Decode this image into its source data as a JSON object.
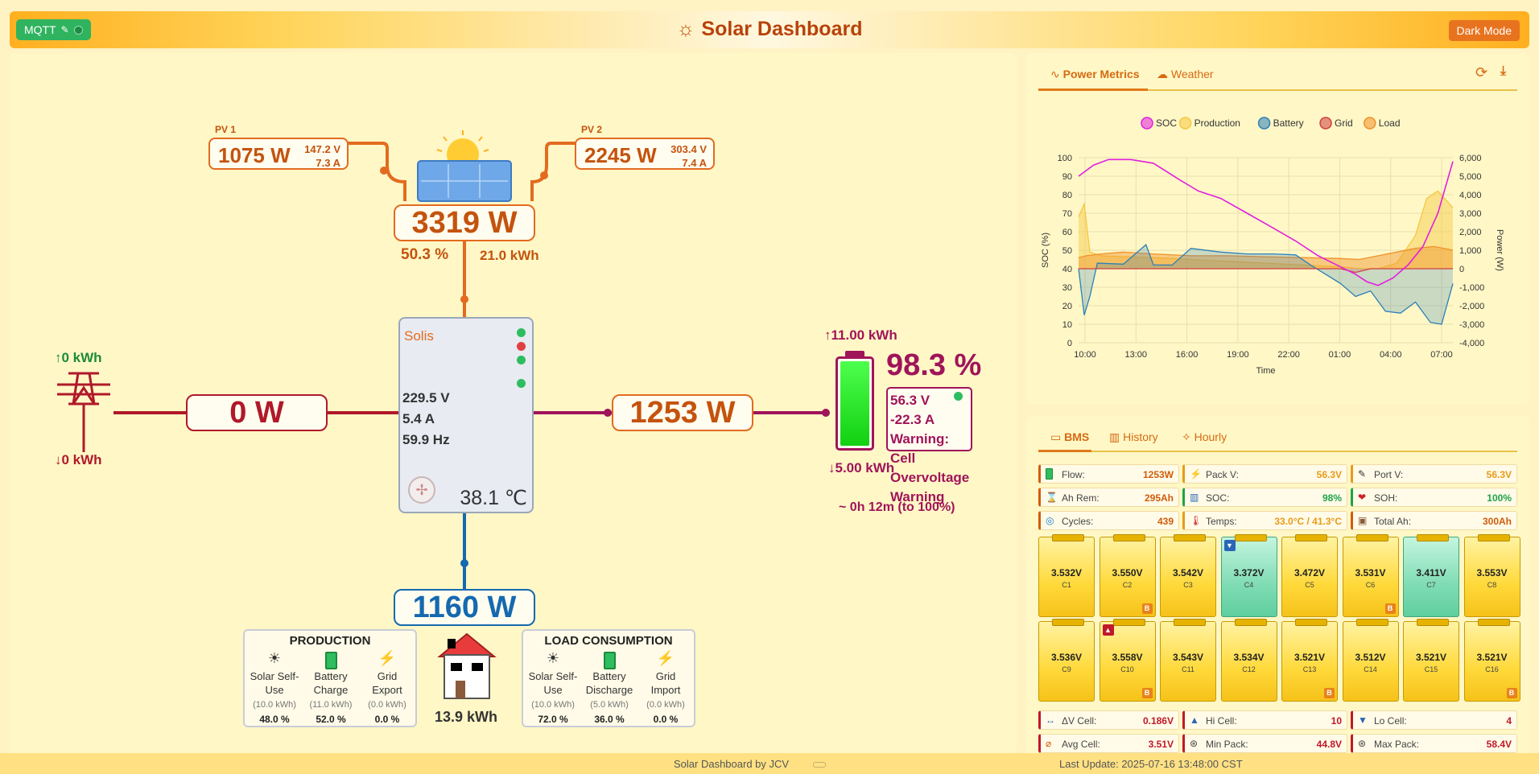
{
  "header": {
    "mqtt_label": "MQTT",
    "title": "Solar Dashboard",
    "dark_mode_label": "Dark Mode"
  },
  "flow": {
    "pv1": {
      "label": "PV 1",
      "power": "1075 W",
      "voltage": "147.2 V",
      "current": "7.3 A"
    },
    "pv2": {
      "label": "PV 2",
      "power": "2245 W",
      "voltage": "303.4 V",
      "current": "7.4 A"
    },
    "pv_total": "3319 W",
    "pv_percent": "50.3 %",
    "pv_energy": "21.0 kWh",
    "grid": {
      "import_energy": "↑0 kWh",
      "export_energy": "↓0 kWh",
      "power": "0 W"
    },
    "inverter": {
      "brand": "Solis",
      "voltage": "229.5 V",
      "current": "5.4 A",
      "frequency": "59.9 Hz",
      "temperature": "38.1 ℃"
    },
    "battery_flow_power": "1253 W",
    "battery": {
      "charge_energy": "↑11.00 kWh",
      "discharge_energy": "↓5.00 kWh",
      "soc": "98.3 %",
      "voltage": "56.3 V",
      "current": "-22.3 A",
      "warning_lines": [
        "Warning:",
        "Cell",
        "Overvoltage",
        "Warning"
      ],
      "time_to_full": "~ 0h 12m (to 100%)"
    },
    "load_power": "1160 W",
    "home_energy": "13.9 kWh",
    "production": {
      "title": "PRODUCTION",
      "items": [
        {
          "icon": "sun-icon",
          "label1": "Solar Self-",
          "label2": "Use",
          "energy": "(10.0 kWh)",
          "percent": "48.0 %"
        },
        {
          "icon": "battery-icon",
          "label1": "Battery",
          "label2": "Charge",
          "energy": "(11.0 kWh)",
          "percent": "52.0 %"
        },
        {
          "icon": "lightning-icon",
          "label1": "Grid",
          "label2": "Export",
          "energy": "(0.0 kWh)",
          "percent": "0.0 %"
        }
      ]
    },
    "consumption": {
      "title": "LOAD CONSUMPTION",
      "items": [
        {
          "icon": "sun-icon",
          "label1": "Solar Self-",
          "label2": "Use",
          "energy": "(10.0 kWh)",
          "percent": "72.0 %"
        },
        {
          "icon": "battery-icon",
          "label1": "Battery",
          "label2": "Discharge",
          "energy": "(5.0 kWh)",
          "percent": "36.0 %"
        },
        {
          "icon": "lightning-icon",
          "label1": "Grid",
          "label2": "Import",
          "energy": "(0.0 kWh)",
          "percent": "0.0 %"
        }
      ]
    }
  },
  "chart_panel": {
    "tabs": [
      "Power Metrics",
      "Weather"
    ],
    "active_tab": "Power Metrics"
  },
  "chart_data": {
    "type": "line",
    "xlabel": "Time",
    "ylabel_left": "SOC (%)",
    "ylabel_right": "Power (W)",
    "x_ticks": [
      "10:00",
      "13:00",
      "16:00",
      "19:00",
      "22:00",
      "01:00",
      "04:00",
      "07:00"
    ],
    "ylim_left": [
      0,
      100
    ],
    "y_ticks_left": [
      "0",
      "10",
      "20",
      "30",
      "40",
      "50",
      "60",
      "70",
      "80",
      "90",
      "100"
    ],
    "ylim_right": [
      -4000,
      6000
    ],
    "y_ticks_right": [
      "-4,000",
      "-3,000",
      "-2,000",
      "-1,000",
      "0",
      "1,000",
      "2,000",
      "3,000",
      "4,000",
      "5,000",
      "6,000"
    ],
    "legend_position": "top",
    "series": [
      {
        "name": "SOC",
        "color": "#e020e0",
        "axis": "left",
        "x": [
          0,
          0.04,
          0.08,
          0.14,
          0.2,
          0.27,
          0.32,
          0.38,
          0.45,
          0.52,
          0.58,
          0.64,
          0.7,
          0.74,
          0.77,
          0.8,
          0.84,
          0.88,
          0.92,
          0.96,
          1.0
        ],
        "values": [
          90,
          96,
          99,
          99,
          97,
          88,
          82,
          78,
          70,
          62,
          55,
          47,
          41,
          37,
          33,
          31,
          35,
          42,
          52,
          70,
          98
        ]
      },
      {
        "name": "Production",
        "color": "#f5c842",
        "axis": "right",
        "x": [
          0,
          0.015,
          0.03,
          0.06,
          0.12,
          0.2,
          0.3,
          0.4,
          0.5,
          0.6,
          0.7,
          0.75,
          0.8,
          0.85,
          0.9,
          0.93,
          0.96,
          1.0
        ],
        "values": [
          2800,
          3500,
          900,
          700,
          650,
          600,
          500,
          400,
          300,
          200,
          100,
          0,
          0,
          300,
          1800,
          3800,
          4200,
          3300
        ]
      },
      {
        "name": "Battery",
        "color": "#2a80b9",
        "axis": "right",
        "x": [
          0,
          0.015,
          0.03,
          0.05,
          0.12,
          0.18,
          0.2,
          0.25,
          0.3,
          0.38,
          0.45,
          0.52,
          0.58,
          0.62,
          0.66,
          0.7,
          0.74,
          0.78,
          0.82,
          0.86,
          0.9,
          0.94,
          0.97,
          1.0
        ],
        "values": [
          0,
          -2500,
          -1500,
          300,
          250,
          1300,
          200,
          200,
          1100,
          900,
          800,
          800,
          750,
          200,
          -300,
          -800,
          -1500,
          -1200,
          -2300,
          -2400,
          -1800,
          -2900,
          -3000,
          -800
        ]
      },
      {
        "name": "Grid",
        "color": "#d04040",
        "axis": "right",
        "x": [
          0,
          0.5,
          0.7,
          0.74,
          0.78,
          1.0
        ],
        "values": [
          0,
          0,
          0,
          -200,
          0,
          0
        ]
      },
      {
        "name": "Load",
        "color": "#f0922a",
        "axis": "right",
        "x": [
          0,
          0.02,
          0.06,
          0.12,
          0.2,
          0.3,
          0.4,
          0.5,
          0.6,
          0.7,
          0.75,
          0.8,
          0.85,
          0.9,
          0.95,
          1.0
        ],
        "values": [
          600,
          700,
          800,
          900,
          800,
          700,
          700,
          650,
          600,
          550,
          500,
          700,
          900,
          1100,
          1200,
          1000
        ]
      }
    ]
  },
  "bms_panel": {
    "tabs": [
      "BMS",
      "History",
      "Hourly"
    ],
    "active_tab": "BMS",
    "metrics": [
      {
        "icon": "battery-green-icon",
        "label": "Flow:",
        "value": "1253W",
        "color": "#d05c0c"
      },
      {
        "icon": "lightning-icon",
        "label": "Pack V:",
        "value": "56.3V",
        "color": "#e89a1a"
      },
      {
        "icon": "plug-icon",
        "label": "Port V:",
        "value": "56.3V",
        "color": "#e89a1a"
      },
      {
        "icon": "hourglass-icon",
        "label": "Ah Rem:",
        "value": "295Ah",
        "color": "#d05c0c"
      },
      {
        "icon": "bar-chart-icon",
        "label": "SOC:",
        "value": "98%",
        "color": "#1fa34a"
      },
      {
        "icon": "heart-icon",
        "label": "SOH:",
        "value": "100%",
        "color": "#1fa34a"
      },
      {
        "icon": "cycle-icon",
        "label": "Cycles:",
        "value": "439",
        "color": "#d05c0c"
      },
      {
        "icon": "thermometer-icon",
        "label": "Temps:",
        "value": "33.0°C / 41.3°C",
        "color": "#e89a1a"
      },
      {
        "icon": "box-icon",
        "label": "Total Ah:",
        "value": "300Ah",
        "color": "#d05c0c"
      }
    ],
    "cells": [
      {
        "voltage": "3.532V",
        "name": "C1",
        "low": false,
        "balancing": false,
        "mark": ""
      },
      {
        "voltage": "3.550V",
        "name": "C2",
        "low": false,
        "balancing": true,
        "mark": ""
      },
      {
        "voltage": "3.542V",
        "name": "C3",
        "low": false,
        "balancing": false,
        "mark": ""
      },
      {
        "voltage": "3.372V",
        "name": "C4",
        "low": true,
        "balancing": false,
        "mark": "min"
      },
      {
        "voltage": "3.472V",
        "name": "C5",
        "low": false,
        "balancing": false,
        "mark": ""
      },
      {
        "voltage": "3.531V",
        "name": "C6",
        "low": false,
        "balancing": true,
        "mark": ""
      },
      {
        "voltage": "3.411V",
        "name": "C7",
        "low": true,
        "balancing": false,
        "mark": ""
      },
      {
        "voltage": "3.553V",
        "name": "C8",
        "low": false,
        "balancing": false,
        "mark": ""
      },
      {
        "voltage": "3.536V",
        "name": "C9",
        "low": false,
        "balancing": false,
        "mark": ""
      },
      {
        "voltage": "3.558V",
        "name": "C10",
        "low": false,
        "balancing": true,
        "mark": "max"
      },
      {
        "voltage": "3.543V",
        "name": "C11",
        "low": false,
        "balancing": false,
        "mark": ""
      },
      {
        "voltage": "3.534V",
        "name": "C12",
        "low": false,
        "balancing": false,
        "mark": ""
      },
      {
        "voltage": "3.521V",
        "name": "C13",
        "low": false,
        "balancing": true,
        "mark": ""
      },
      {
        "voltage": "3.512V",
        "name": "C14",
        "low": false,
        "balancing": false,
        "mark": ""
      },
      {
        "voltage": "3.521V",
        "name": "C15",
        "low": false,
        "balancing": false,
        "mark": ""
      },
      {
        "voltage": "3.521V",
        "name": "C16",
        "low": false,
        "balancing": true,
        "mark": ""
      }
    ],
    "balance_badge": "B",
    "summary": [
      {
        "icon": "delta-icon",
        "label": "ΔV Cell:",
        "value": "0.186V",
        "color": "#c0182a"
      },
      {
        "icon": "arrow-up-icon",
        "label": "Hi Cell:",
        "value": "10",
        "color": "#c0182a"
      },
      {
        "icon": "arrow-down-icon",
        "label": "Lo Cell:",
        "value": "4",
        "color": "#c0182a"
      },
      {
        "icon": "average-icon",
        "label": "Avg Cell:",
        "value": "3.51V",
        "color": "#c0182a"
      },
      {
        "icon": "gauge-icon",
        "label": "Min Pack:",
        "value": "44.8V",
        "color": "#c0182a"
      },
      {
        "icon": "gauge-icon",
        "label": "Max Pack:",
        "value": "58.4V",
        "color": "#c0182a"
      }
    ]
  },
  "footer": {
    "credit": "Solar Dashboard by JCV",
    "last_update": "Last Update: 2025-07-16 13:48:00 CST"
  }
}
